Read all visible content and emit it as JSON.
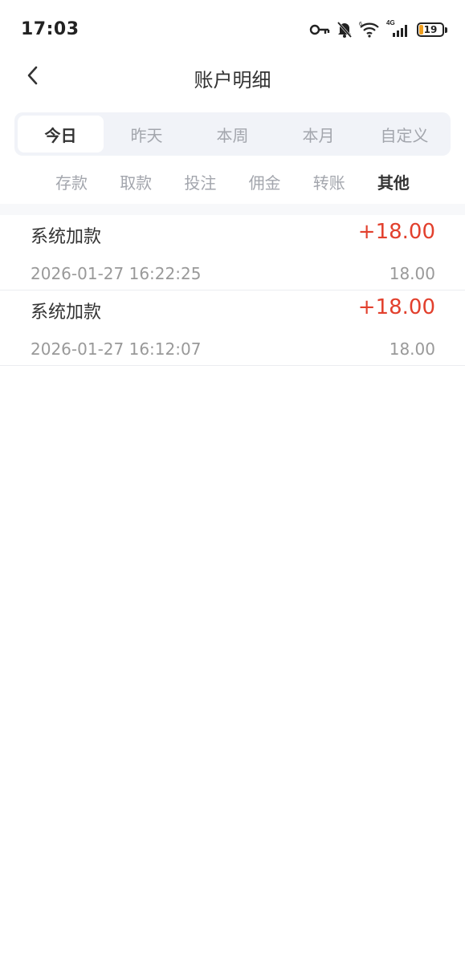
{
  "status_bar": {
    "time": "17:03",
    "icons": [
      "key-icon",
      "bell-muted-icon",
      "wifi-icon",
      "signal-4g-icon",
      "battery-icon"
    ],
    "network_label": "4G",
    "battery_level": "19",
    "battery_color": "#f0a020"
  },
  "header": {
    "title": "账户明细"
  },
  "time_tabs": [
    {
      "label": "今日",
      "active": true
    },
    {
      "label": "昨天",
      "active": false
    },
    {
      "label": "本周",
      "active": false
    },
    {
      "label": "本月",
      "active": false
    },
    {
      "label": "自定义",
      "active": false
    }
  ],
  "category_tabs": [
    {
      "label": "存款",
      "active": false
    },
    {
      "label": "取款",
      "active": false
    },
    {
      "label": "投注",
      "active": false
    },
    {
      "label": "佣金",
      "active": false
    },
    {
      "label": "转账",
      "active": false
    },
    {
      "label": "其他",
      "active": true
    }
  ],
  "records": [
    {
      "title": "系统加款",
      "amount": "+18.00",
      "time": "2026-01-27 16:22:25",
      "balance": "18.00"
    },
    {
      "title": "系统加款",
      "amount": "+18.00",
      "time": "2026-01-27 16:12:07",
      "balance": "18.00"
    }
  ],
  "colors": {
    "amount_positive": "#e2402d",
    "tab_bg": "#f1f3f8",
    "inactive_text": "#a3a6ad"
  }
}
